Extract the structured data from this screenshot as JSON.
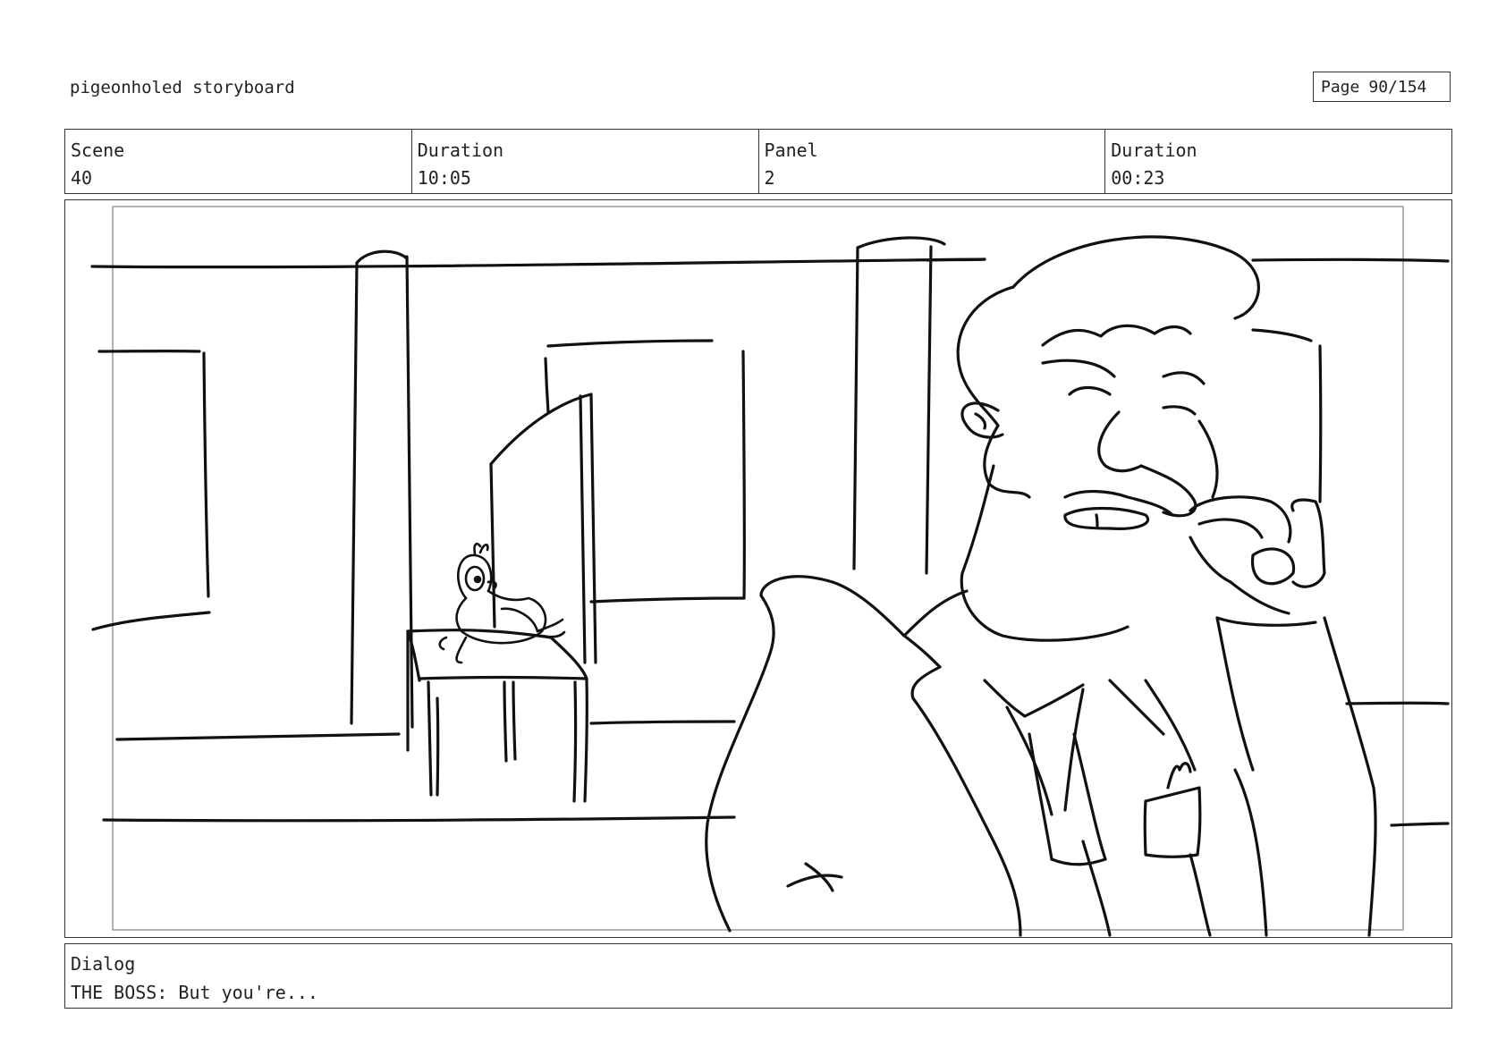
{
  "document": {
    "title": "pigeonholed storyboard",
    "page_label": "Page",
    "page_number": "90/154"
  },
  "info": {
    "scene_label": "Scene",
    "scene_value": "40",
    "scene_duration_label": "Duration",
    "scene_duration_value": "10:05",
    "panel_label": "Panel",
    "panel_value": "2",
    "panel_duration_label": "Duration",
    "panel_duration_value": "00:23"
  },
  "dialog": {
    "label": "Dialog",
    "text": "THE BOSS: But you're..."
  }
}
